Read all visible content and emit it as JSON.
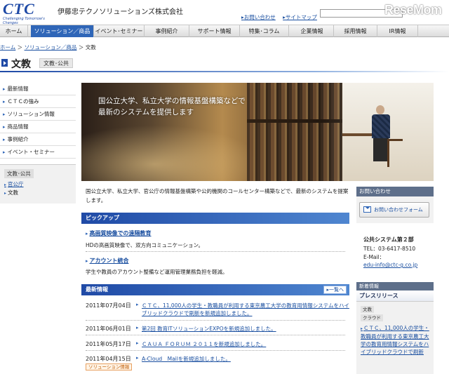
{
  "header": {
    "logo_text": "CTC",
    "logo_tagline": "Challenging Tomorrow's Changes",
    "company_name": "伊藤忠テクノソリューションズ株式会社",
    "link_contact": "お問い合わせ",
    "link_sitemap": "サイトマップ",
    "watermark": "ReseMom"
  },
  "nav": {
    "items": [
      "ホーム",
      "ソリューション／商品",
      "イベント･セミナー",
      "事例紹介",
      "サポート情報",
      "特集･コラム",
      "企業情報",
      "採用情報",
      "IR情報"
    ]
  },
  "breadcrumb": {
    "home": "ホーム",
    "solutions": "ソリューション／商品",
    "current": "文教"
  },
  "page": {
    "title": "文教",
    "subtitle": "文教･公共"
  },
  "sidebar": {
    "items": [
      "最新情報",
      "ＣＴＣの強み",
      "ソリューション情報",
      "商品情報",
      "事例紹介",
      "イベント・セミナー"
    ],
    "sub_header": "文教･公共",
    "sub_link": "官公庁",
    "sub_current": "文教"
  },
  "hero": {
    "line1": "国公立大学、私立大学の情報基盤構築などで",
    "line2": "最新のシステムを提供します"
  },
  "lead": "国公立大学、私立大学、官公庁の情報基盤構築や公的機関のコールセンター構築などで、最新のシステムを提案します。",
  "pickup": {
    "title": "ピックアップ",
    "items": [
      {
        "link": "高画質映像での遠隔教育",
        "desc": "HDの高画質映像で、双方向コミュニケーション。"
      },
      {
        "link": "アカウント統合",
        "desc": "学生や教員のアカウント整備など運用管理業務負担を軽減。"
      }
    ]
  },
  "news": {
    "title": "最新情報",
    "all_label": "一覧へ",
    "items": [
      {
        "date": "2011年07月04日",
        "text": "ＣＴＣ、11,000人の学生・教職員が利用する東京農工大学の教育用情報システムをハイブリッドクラウドで刷新を新規追加しました。"
      },
      {
        "date": "2011年06月01日",
        "text": "第2回 教育ITソリューションEXPOを新規追加しました。"
      },
      {
        "date": "2011年05月17日",
        "text": "ＣＡＵＡ ＦＯＲＵＭ ２０１１を新規追加しました。"
      },
      {
        "date": "2011年04月15日",
        "text": "A-Cloud　Mailを新規追加しました。",
        "tag": "ソリューション情報"
      }
    ]
  },
  "contact": {
    "header": "お問い合わせ",
    "button": "お問い合わせフォーム",
    "dept": "公共システム第２部",
    "tel": "TEL：03-6417-8510",
    "email_label": "E-Mail：",
    "email": "edu-info@ctc-g.co.jp"
  },
  "right_news": {
    "header": "新着情報",
    "tab": "プレスリリース",
    "chip1": "文教",
    "chip2": "クラウド",
    "link": "ＣＴＣ、11,000人の学生・教職員が利用する東京農工大学の教育用情報システムをハイブリッドクラウドで刷新"
  }
}
